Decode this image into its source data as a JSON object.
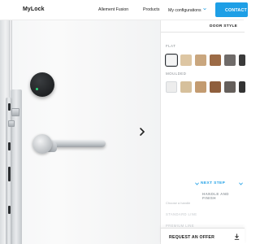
{
  "header": {
    "logo": "MyLock",
    "product_name": "Allement Fusion",
    "nav": {
      "products": "Products",
      "configurations": "My configurations"
    },
    "contact_label": "CONTACT"
  },
  "panel": {
    "section_title": "DOOR STYLE",
    "flat": {
      "label": "FLAT",
      "swatches": [
        {
          "name": "white",
          "color": "#f4f4f4",
          "selected": true
        },
        {
          "name": "light-oak",
          "color": "#ddc6a3"
        },
        {
          "name": "beige-oak",
          "color": "#c9a67e"
        },
        {
          "name": "walnut",
          "color": "#9c6b46"
        },
        {
          "name": "dark-grey",
          "color": "#6f6b69"
        },
        {
          "name": "anthracite",
          "color": "#3a3a3a"
        }
      ]
    },
    "moulded": {
      "label": "MOULDED",
      "swatches": [
        {
          "name": "white-moulded",
          "color": "#ededed"
        },
        {
          "name": "light-oak-moulded",
          "color": "#d6c09c"
        },
        {
          "name": "beige-oak-moulded",
          "color": "#c39b70"
        },
        {
          "name": "walnut-moulded",
          "color": "#8f5f3d"
        },
        {
          "name": "dark-grey-moulded",
          "color": "#655f5b"
        },
        {
          "name": "anthracite-moulded",
          "color": "#333333"
        }
      ]
    },
    "next_step": "NEXT STEP",
    "next_section": "HANDLE AND FINISH",
    "choose_handle": "Choose a handle",
    "standard_line": "STANDARD LINE",
    "premium_line": "PREMIUM LINE",
    "request_offer": "REQUEST AN OFFER"
  },
  "colors": {
    "accent": "#1e9fe6",
    "smartlock_led": "#2fd37a"
  }
}
